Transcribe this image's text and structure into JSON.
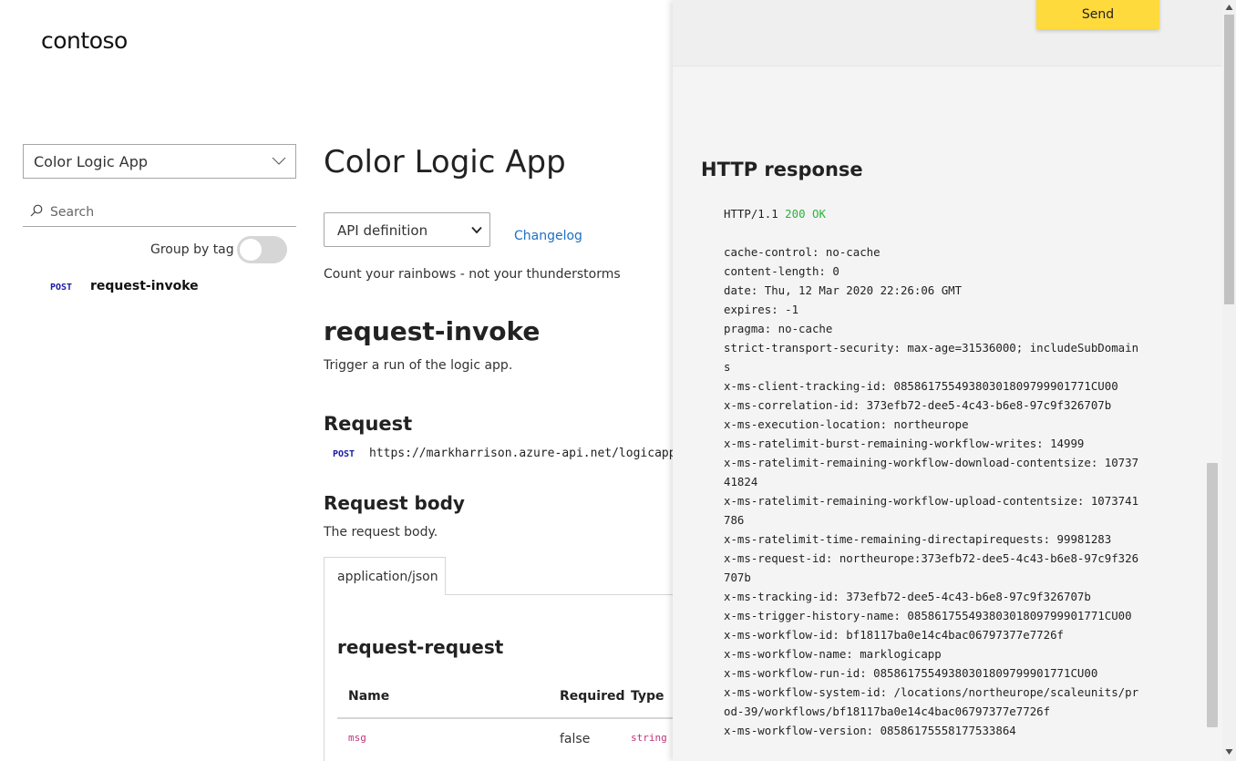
{
  "brand": {
    "logo": "contoso"
  },
  "sidebar": {
    "api_select": "Color Logic App",
    "search_placeholder": "Search",
    "group_by_tag_label": "Group by tag",
    "operations": [
      {
        "method": "POST",
        "name": "request-invoke"
      }
    ]
  },
  "main": {
    "title": "Color Logic App",
    "definition_select": "API definition",
    "changelog": "Changelog",
    "description": "Count your rainbows - not your thunderstorms",
    "operation": {
      "title": "request-invoke",
      "description": "Trigger a run of the logic app.",
      "request_heading": "Request",
      "method": "POST",
      "url": "https://markharrison.azure-api.net/logicapp/",
      "body_heading": "Request body",
      "body_description": "The request body.",
      "content_type_tab": "application/json",
      "schema_name": "request-request",
      "table": {
        "headers": [
          "Name",
          "Required",
          "Type"
        ],
        "rows": [
          {
            "name": "msg",
            "required": "false",
            "type": "string"
          }
        ]
      }
    }
  },
  "console": {
    "send_label": "Send",
    "response_heading": "HTTP response",
    "status_line": {
      "protocol": "HTTP/1.1",
      "status": "200 OK",
      "status_color": "#2bb33a"
    },
    "headers": [
      "cache-control: no-cache",
      "content-length: 0",
      "date: Thu, 12 Mar 2020 22:26:06 GMT",
      "expires: -1",
      "pragma: no-cache",
      "strict-transport-security: max-age=31536000; includeSubDomain",
      "s",
      "x-ms-client-tracking-id: 08586175549380301809799901771CU00",
      "x-ms-correlation-id: 373efb72-dee5-4c43-b6e8-97c9f326707b",
      "x-ms-execution-location: northeurope",
      "x-ms-ratelimit-burst-remaining-workflow-writes: 14999",
      "x-ms-ratelimit-remaining-workflow-download-contentsize: 10737",
      "41824",
      "x-ms-ratelimit-remaining-workflow-upload-contentsize: 1073741",
      "786",
      "x-ms-ratelimit-time-remaining-directapirequests: 99981283",
      "x-ms-request-id: northeurope:373efb72-dee5-4c43-b6e8-97c9f326",
      "707b",
      "x-ms-tracking-id: 373efb72-dee5-4c43-b6e8-97c9f326707b",
      "x-ms-trigger-history-name: 08586175549380301809799901771CU00",
      "x-ms-workflow-id: bf18117ba0e14c4bac06797377e7726f",
      "x-ms-workflow-name: marklogicapp",
      "x-ms-workflow-run-id: 08586175549380301809799901771CU00",
      "x-ms-workflow-system-id: /locations/northeurope/scaleunits/pr",
      "od-39/workflows/bf18117ba0e14c4bac06797377e7726f",
      "x-ms-workflow-version: 08586175558177533864"
    ]
  },
  "colors": {
    "accent_link": "#1f6fc4",
    "send_button": "#ffda3d",
    "method_post": "#1a1aa6"
  }
}
